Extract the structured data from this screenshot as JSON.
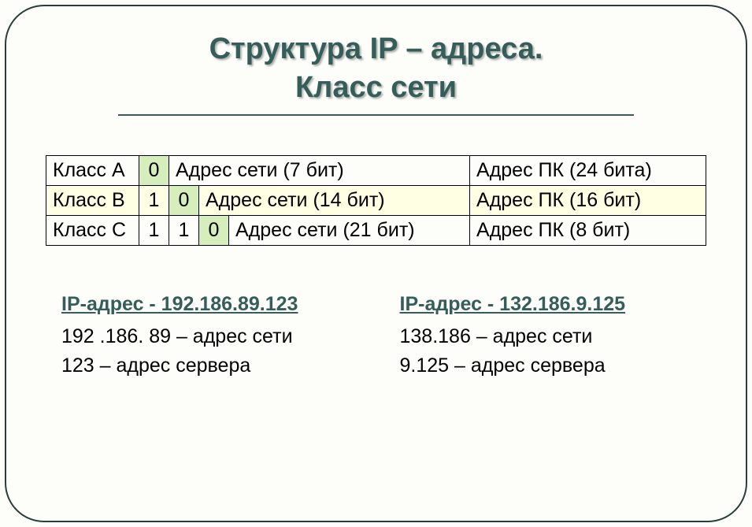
{
  "title_line1": "Структура IP – адреса.",
  "title_line2": "Класс сети",
  "table": {
    "rowA": {
      "class": "Класс А",
      "bit0": "0",
      "net": "Адрес сети (7 бит)",
      "host": "Адрес ПК (24 бита)"
    },
    "rowB": {
      "class": "Класс В",
      "bit0": "1",
      "bit1": "0",
      "net": "Адрес сети (14 бит)",
      "host": "Адрес ПК (16 бит)"
    },
    "rowC": {
      "class": "Класс С",
      "bit0": "1",
      "bit1": "1",
      "bit2": "0",
      "net": "Адрес сети (21 бит)",
      "host": "Адрес ПК (8 бит)"
    }
  },
  "example1": {
    "header": "IP-адрес - 192.186.89.123",
    "net": "192 .186. 89 – адрес сети",
    "host": "123 – адрес сервера"
  },
  "example2": {
    "header": "IP-адрес - 132.186.9.125",
    "net": "138.186 – адрес сети",
    "host": "9.125 – адрес сервера"
  }
}
